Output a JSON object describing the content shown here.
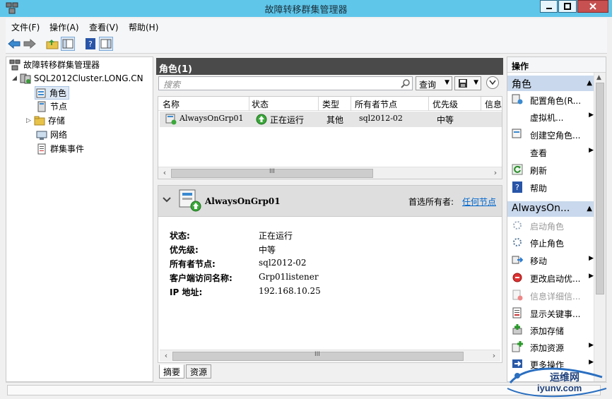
{
  "window": {
    "title": "故障转移群集管理器"
  },
  "menu": [
    "文件(F)",
    "操作(A)",
    "查看(V)",
    "帮助(H)"
  ],
  "tree": {
    "root": "故障转移群集管理器",
    "cluster": "SQL2012Cluster.LONG.CN",
    "items": [
      "角色",
      "节点",
      "存储",
      "网络",
      "群集事件"
    ]
  },
  "roles": {
    "header": "角色(1)",
    "search_placeholder": "搜索",
    "query_label": "查询",
    "columns": [
      "名称",
      "状态",
      "类型",
      "所有者节点",
      "优先级",
      "信息"
    ],
    "rows": [
      {
        "name": "AlwaysOnGrp01",
        "status": "正在运行",
        "type": "其他",
        "owner": "sql2012-02",
        "priority": "中等"
      }
    ]
  },
  "detail": {
    "name": "AlwaysOnGrp01",
    "preferred_label": "首选所有者:",
    "preferred_link": "任何节点",
    "fields": [
      {
        "label": "状态:",
        "value": "正在运行"
      },
      {
        "label": "优先级:",
        "value": "中等"
      },
      {
        "label": "所有者节点:",
        "value": "sql2012-02"
      },
      {
        "label": "客户端访问名称:",
        "value": "Grp01listener"
      },
      {
        "label": "IP 地址:",
        "value": "192.168.10.25"
      }
    ],
    "tabs": [
      "摘要",
      "资源"
    ]
  },
  "actions": {
    "title": "操作",
    "group1": "角色",
    "group1_items": [
      "配置角色(R...",
      "虚拟机...",
      "创建空角色...",
      "查看",
      "刷新",
      "帮助"
    ],
    "group2": "AlwaysOn...",
    "group2_items": [
      "启动角色",
      "停止角色",
      "移动",
      "更改启动优...",
      "信息详细信...",
      "显示关键事...",
      "添加存储",
      "添加资源",
      "更多操作"
    ]
  },
  "watermark": {
    "text": "运维网",
    "url": "iyunv.com"
  },
  "colors": {
    "titlebar": "#5fc6ea",
    "header": "#4a4a4a",
    "group": "#c9d8ec",
    "link": "#0066cc",
    "running": "#3aa83a"
  }
}
